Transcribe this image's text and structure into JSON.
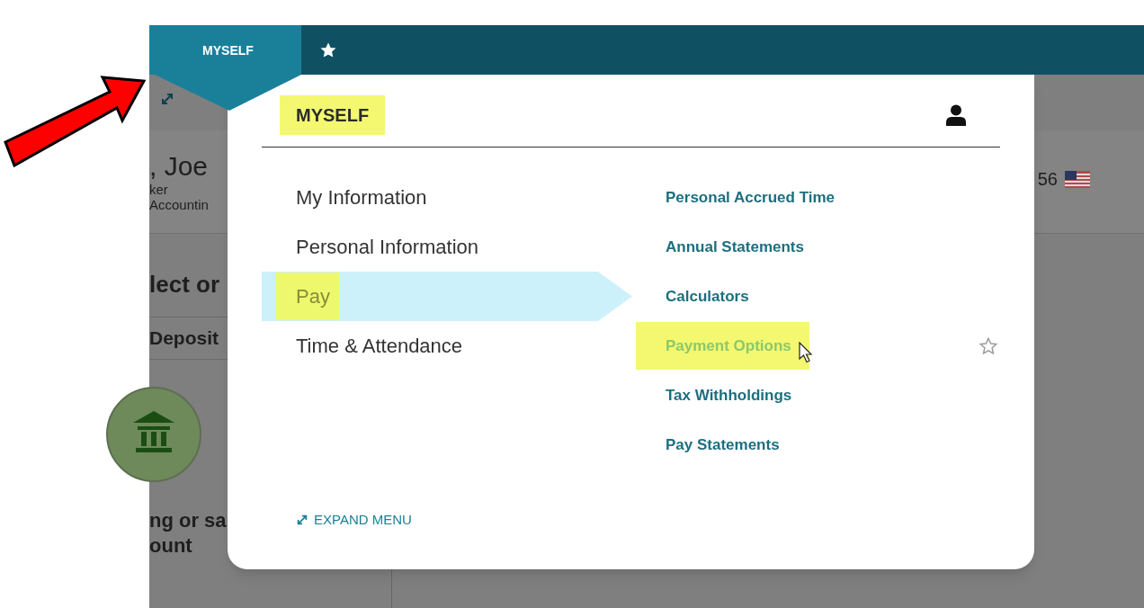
{
  "nav": {
    "tabs": [
      {
        "kind": "text",
        "label": "MYSELF",
        "selected": true
      },
      {
        "kind": "star",
        "selected": false
      }
    ]
  },
  "background": {
    "name_fragment": ", Joe",
    "line_1": "ker",
    "line_2": "Accountin",
    "number_fragment": "56",
    "heading": "lect or",
    "tab": "Deposit",
    "caption_lines": [
      "ng or sa",
      "ount"
    ]
  },
  "menu": {
    "title": "MYSELF",
    "title_highlighted": true,
    "categories": [
      {
        "label": "My Information",
        "selected": false,
        "highlighted": false
      },
      {
        "label": "Personal Information",
        "selected": false,
        "highlighted": false
      },
      {
        "label": "Pay",
        "selected": true,
        "highlighted": true
      },
      {
        "label": "Time & Attendance",
        "selected": false,
        "highlighted": false
      }
    ],
    "links": [
      {
        "label": "Personal Accrued Time",
        "highlighted": false,
        "hovered": false
      },
      {
        "label": "Annual Statements",
        "highlighted": false,
        "hovered": false
      },
      {
        "label": "Calculators",
        "highlighted": false,
        "hovered": false
      },
      {
        "label": "Payment Options",
        "highlighted": true,
        "hovered": true
      },
      {
        "label": "Tax Withholdings",
        "highlighted": false,
        "hovered": false
      },
      {
        "label": "Pay Statements",
        "highlighted": false,
        "hovered": false
      }
    ],
    "expand_label": "EXPAND MENU"
  }
}
